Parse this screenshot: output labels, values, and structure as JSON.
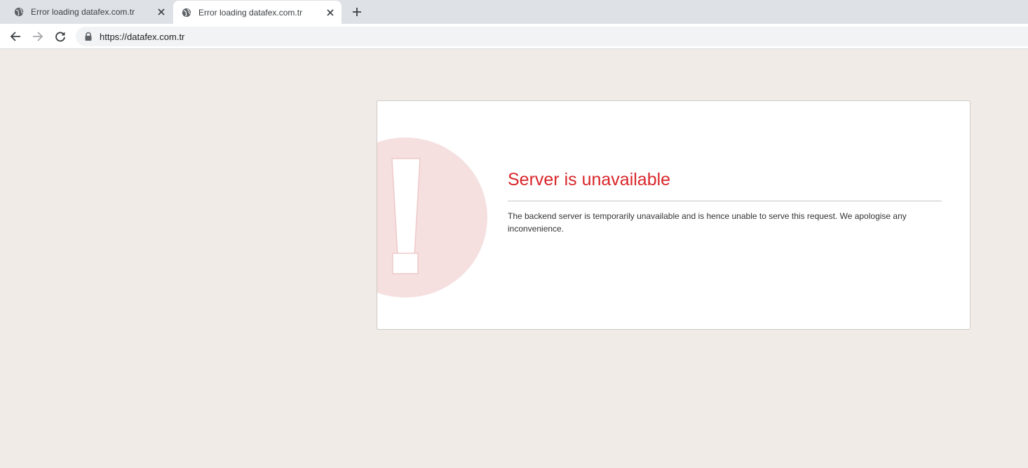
{
  "tabs": [
    {
      "title": "Error loading datafex.com.tr",
      "active": false
    },
    {
      "title": "Error loading datafex.com.tr",
      "active": true
    }
  ],
  "toolbar": {
    "url": "https://datafex.com.tr"
  },
  "error": {
    "heading": "Server is unavailable",
    "message": "The backend server is temporarily unavailable and is hence unable to serve this request. We apologise any inconvenience."
  },
  "colors": {
    "heading": "#d9262a",
    "graphic": "#f5dfdf",
    "page_background": "#f0ebe7"
  },
  "icons": {
    "favicon": "globe-icon",
    "close": "close-icon",
    "new_tab": "plus-icon",
    "back": "back-arrow-icon",
    "forward": "forward-arrow-icon",
    "reload": "reload-icon",
    "secure": "lock-icon",
    "alert": "exclamation-icon"
  }
}
